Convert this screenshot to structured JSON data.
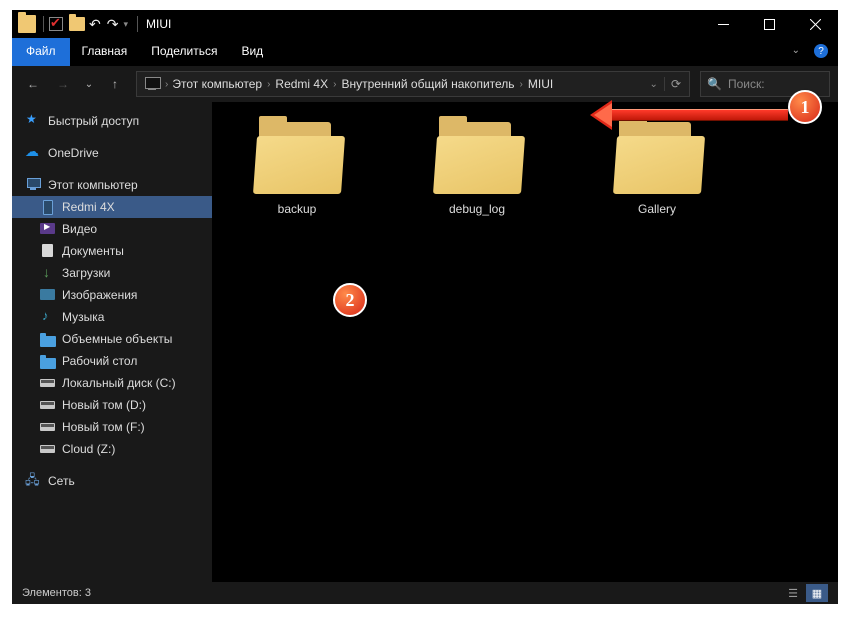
{
  "titlebar": {
    "title": "MIUI"
  },
  "ribbon": {
    "file": "Файл",
    "tabs": [
      "Главная",
      "Поделиться",
      "Вид"
    ]
  },
  "breadcrumbs": [
    "Этот компьютер",
    "Redmi 4X",
    "Внутренний общий накопитель",
    "MIUI"
  ],
  "search": {
    "placeholder": "Поиск:"
  },
  "sidebar": {
    "quick_access": "Быстрый доступ",
    "onedrive": "OneDrive",
    "this_pc": "Этот компьютер",
    "items": [
      {
        "label": "Redmi 4X"
      },
      {
        "label": "Видео"
      },
      {
        "label": "Документы"
      },
      {
        "label": "Загрузки"
      },
      {
        "label": "Изображения"
      },
      {
        "label": "Музыка"
      },
      {
        "label": "Объемные объекты"
      },
      {
        "label": "Рабочий стол"
      },
      {
        "label": "Локальный диск (C:)"
      },
      {
        "label": "Новый том (D:)"
      },
      {
        "label": "Новый том (F:)"
      },
      {
        "label": "Cloud (Z:)"
      }
    ],
    "network": "Сеть"
  },
  "folders": [
    {
      "name": "backup"
    },
    {
      "name": "debug_log"
    },
    {
      "name": "Gallery"
    }
  ],
  "status": {
    "count_label": "Элементов: 3"
  },
  "callouts": {
    "one": "1",
    "two": "2"
  }
}
